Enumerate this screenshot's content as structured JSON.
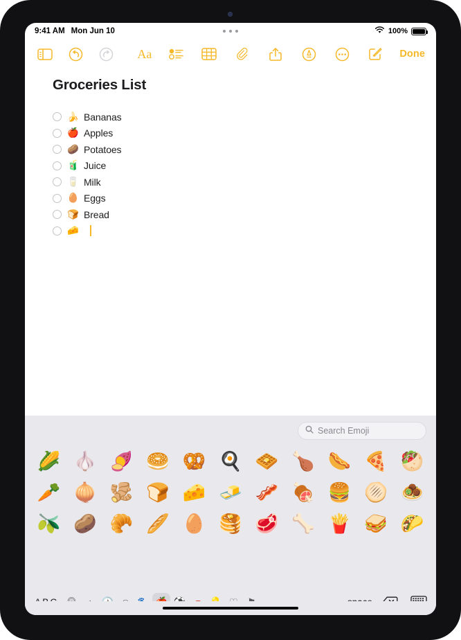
{
  "status_bar": {
    "time": "9:41 AM",
    "date": "Mon Jun 10",
    "battery_percent": "100%",
    "wifi_icon": "wifi-icon",
    "battery_icon": "battery-icon",
    "multitask_icon": "multitasking-dots-icon"
  },
  "toolbar": {
    "sidebar_icon": "sidebar-toggle-icon",
    "undo_icon": "undo-icon",
    "redo_icon": "redo-icon",
    "format_label": "Aa",
    "checklist_icon": "checklist-icon",
    "table_icon": "table-icon",
    "attach_icon": "paperclip-icon",
    "share_icon": "share-icon",
    "markup_icon": "markup-pen-icon",
    "more_icon": "more-ellipsis-icon",
    "compose_icon": "compose-icon",
    "done_label": "Done"
  },
  "note": {
    "title": "Groceries List",
    "items": [
      {
        "emoji": "🍌",
        "label": "Bananas",
        "checked": false
      },
      {
        "emoji": "🍎",
        "label": "Apples",
        "checked": false
      },
      {
        "emoji": "🥔",
        "label": "Potatoes",
        "checked": false
      },
      {
        "emoji": "🧃",
        "label": "Juice",
        "checked": false
      },
      {
        "emoji": "🥛",
        "label": "Milk",
        "checked": false
      },
      {
        "emoji": "🥚",
        "label": "Eggs",
        "checked": false
      },
      {
        "emoji": "🍞",
        "label": "Bread",
        "checked": false
      },
      {
        "emoji": "🧀",
        "label": "",
        "checked": false,
        "cursor": true
      }
    ]
  },
  "keyboard": {
    "search": {
      "placeholder": "Search Emoji",
      "value": "",
      "icon": "search-icon"
    },
    "emoji_rows": [
      [
        "🌽",
        "🧄",
        "🍠",
        "🥯",
        "🥨",
        "🍳",
        "🧇",
        "🍗",
        "🌭",
        "🍕",
        "🥙"
      ],
      [
        "🥕",
        "🧅",
        "🫚",
        "🍞",
        "🧀",
        "🧈",
        "🥓",
        "🍖",
        "🍔",
        "🫓",
        "🧆"
      ],
      [
        "🫒",
        "🥔",
        "🥐",
        "🥖",
        "🥚",
        "🥞",
        "🥩",
        "🦴",
        "🍟",
        "🥪",
        "🌮"
      ]
    ],
    "abc_label": "ABC",
    "categories": [
      {
        "name": "recent-emoji-category",
        "glyph": "🕰",
        "selected": false
      },
      {
        "name": "smileys-category",
        "glyph": "◖",
        "selected": false
      },
      {
        "name": "clock-category",
        "glyph": "🕐",
        "selected": false
      },
      {
        "name": "emoticons-category",
        "glyph": "☺",
        "selected": false
      },
      {
        "name": "animals-nature-category",
        "glyph": "🐾",
        "selected": false
      },
      {
        "name": "food-drink-category",
        "glyph": "🍎",
        "selected": true
      },
      {
        "name": "activity-category",
        "glyph": "⚽",
        "selected": false
      },
      {
        "name": "travel-places-category",
        "glyph": "🚗",
        "selected": false
      },
      {
        "name": "objects-category",
        "glyph": "💡",
        "selected": false
      },
      {
        "name": "symbols-category",
        "glyph": "♡",
        "selected": false
      },
      {
        "name": "flags-category",
        "glyph": "⚑",
        "selected": false
      }
    ],
    "space_label": "space",
    "delete_icon": "delete-backward-icon",
    "dismiss_icon": "dismiss-keyboard-icon"
  },
  "colors": {
    "accent": "#F5B828",
    "keyboard_bg": "#E8E8ED",
    "note_bg": "#FFFFFF",
    "text": "#1C1C1E"
  }
}
